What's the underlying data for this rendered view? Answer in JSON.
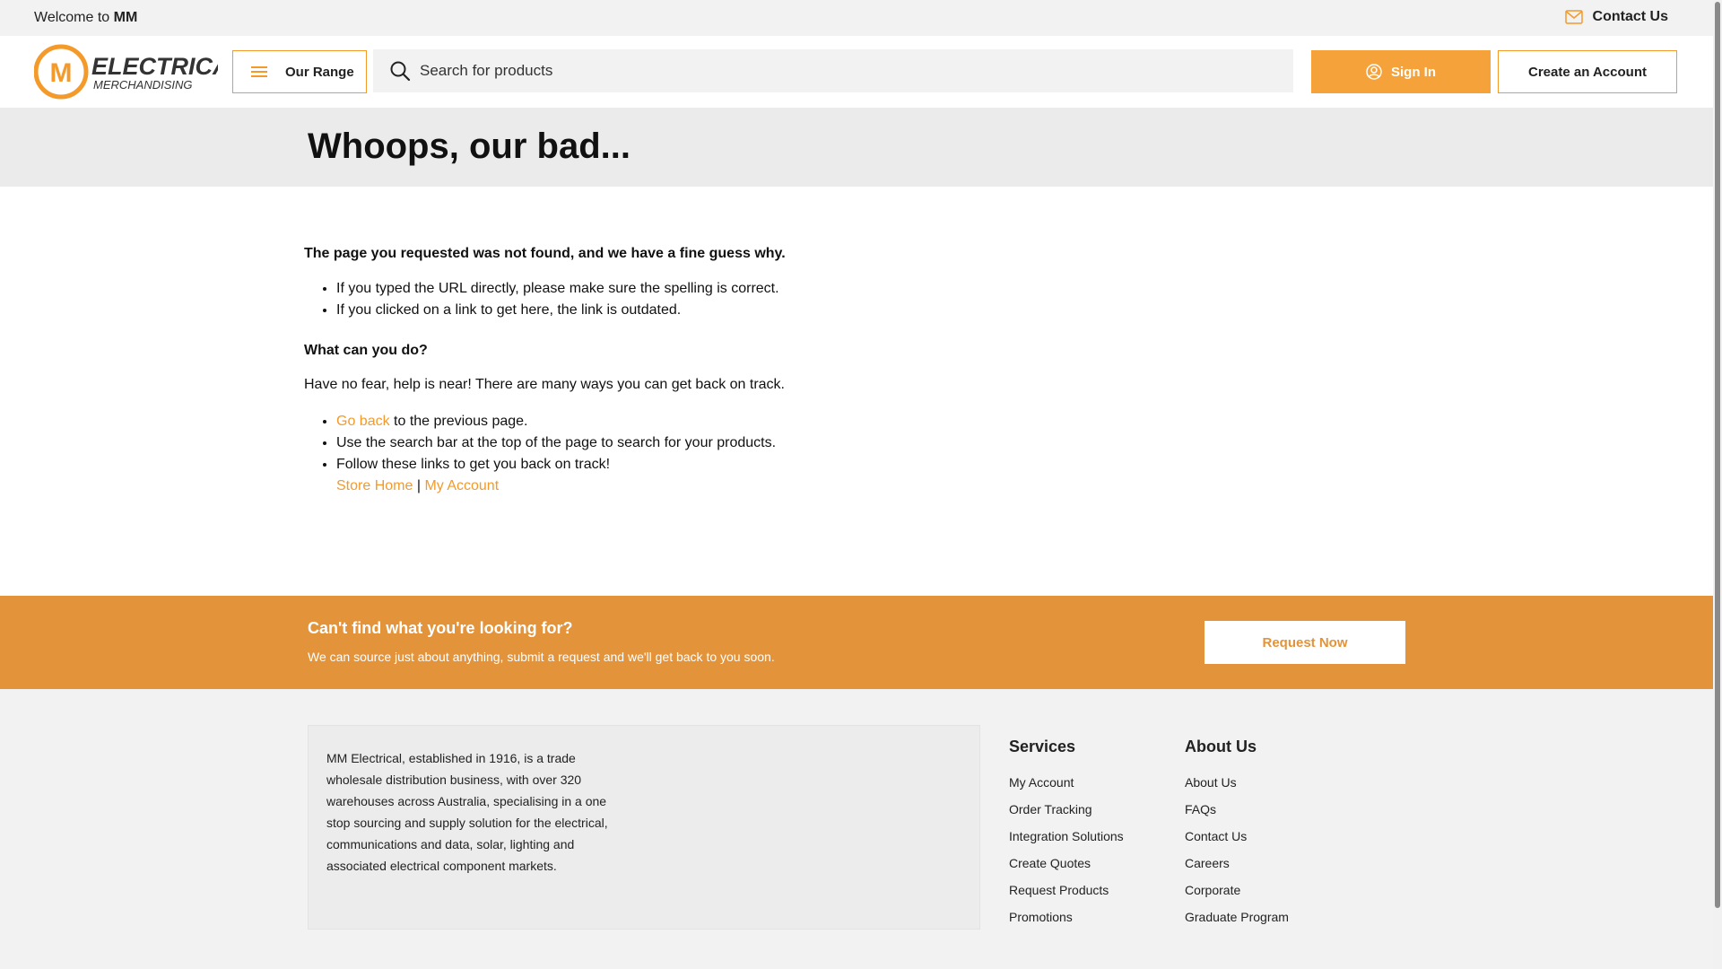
{
  "topbar": {
    "welcome_prefix": "Welcome to",
    "welcome_name": "MM",
    "contact_label": "Contact Us"
  },
  "header": {
    "logo_text_main": "ELECTRICAL",
    "logo_text_sub": "MERCHANDISING",
    "range_label": "Our Range",
    "search_placeholder": "Search for products",
    "signin_label": "Sign In",
    "create_account_label": "Create an Account"
  },
  "page_title": "Whoops, our bad...",
  "content": {
    "lead": "The page you requested was not found, and we have a fine guess why.",
    "reasons": [
      "If you typed the URL directly, please make sure the spelling is correct.",
      "If you clicked on a link to get here, the link is outdated."
    ],
    "question": "What can you do?",
    "paragraph": "Have no fear, help is near! There are many ways you can get back on track.",
    "go_back_link": "Go back",
    "go_back_rest": "to the previous page.",
    "search_tip": "Use the search bar at the top of the page to search for your products.",
    "follow_text": "Follow these links to get you back on track!",
    "store_home_link": "Store Home",
    "separator": "|",
    "my_account_link": "My Account"
  },
  "cta": {
    "title": "Can't find what you're looking for?",
    "subtitle": "We can source just about anything, submit a request and we'll get back to you soon.",
    "button_label": "Request Now"
  },
  "footer": {
    "about_text": "MM Electrical, established in 1916, is a trade wholesale distribution business, with over 320 warehouses across Australia, specialising in a one stop sourcing and supply solution for the electrical, communications and data, solar, lighting and associated electrical component markets.",
    "services": {
      "heading": "Services",
      "links": [
        "My Account",
        "Order Tracking",
        "Integration Solutions",
        "Create Quotes",
        "Request Products",
        "Promotions"
      ]
    },
    "about": {
      "heading": "About Us",
      "links": [
        "About Us",
        "FAQs",
        "Contact Us",
        "Careers",
        "Corporate",
        "Graduate Program"
      ]
    }
  },
  "colors": {
    "accent": "#f6a23a",
    "cta_band": "#e39339",
    "topbar_bg": "#f2f2f2"
  },
  "icons": {
    "contact": "envelope-icon",
    "range": "menu-icon",
    "search": "search-icon",
    "signin": "user-circle-icon"
  }
}
